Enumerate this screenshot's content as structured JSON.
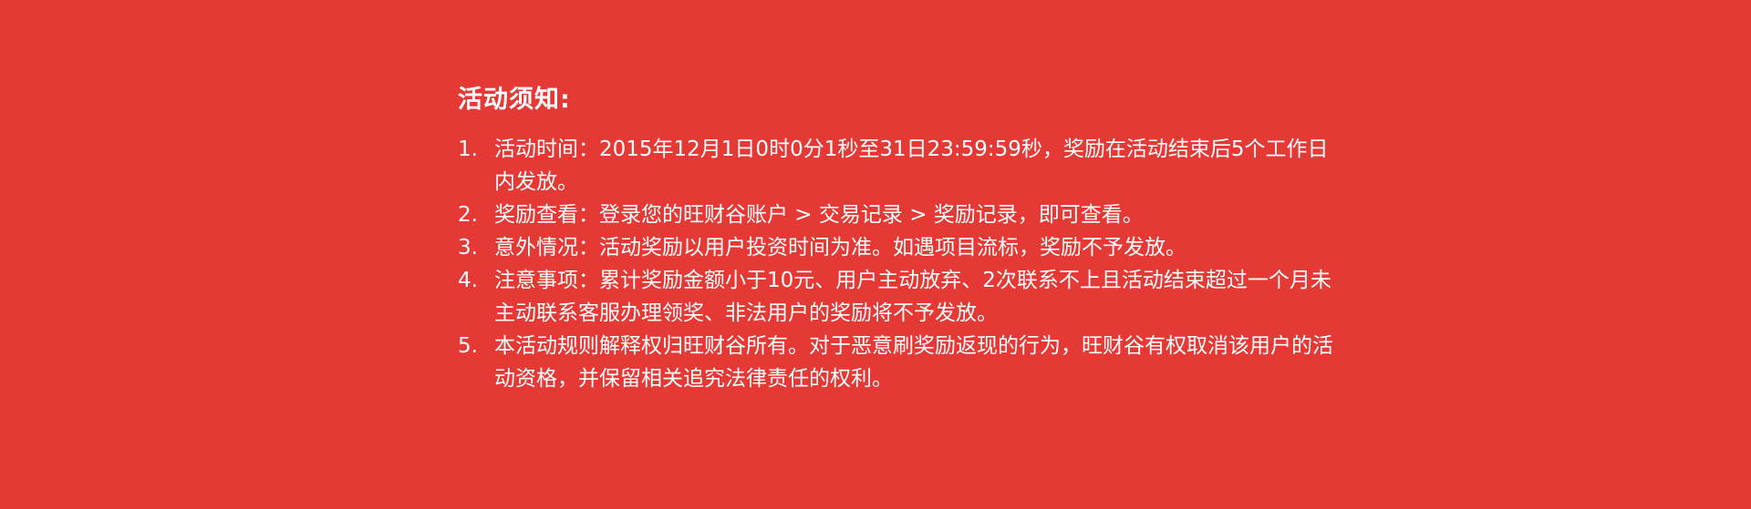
{
  "notice": {
    "title": "活动须知:",
    "rules": [
      {
        "number": "1.",
        "text": "活动时间：2015年12月1日0时0分1秒至31日23:59:59秒，奖励在活动结束后5个工作日内发放。"
      },
      {
        "number": "2.",
        "text": "奖励查看：登录您的旺财谷账户 > 交易记录 > 奖励记录，即可查看。"
      },
      {
        "number": "3.",
        "text": "意外情况：活动奖励以用户投资时间为准。如遇项目流标，奖励不予发放。"
      },
      {
        "number": "4.",
        "text": "注意事项：累计奖励金额小于10元、用户主动放弃、2次联系不上且活动结束超过一个月未主动联系客服办理领奖、非法用户的奖励将不予发放。"
      },
      {
        "number": "5.",
        "text": "本活动规则解释权归旺财谷所有。对于恶意刷奖励返现的行为，旺财谷有权取消该用户的活动资格，并保留相关追究法律责任的权利。"
      }
    ]
  }
}
